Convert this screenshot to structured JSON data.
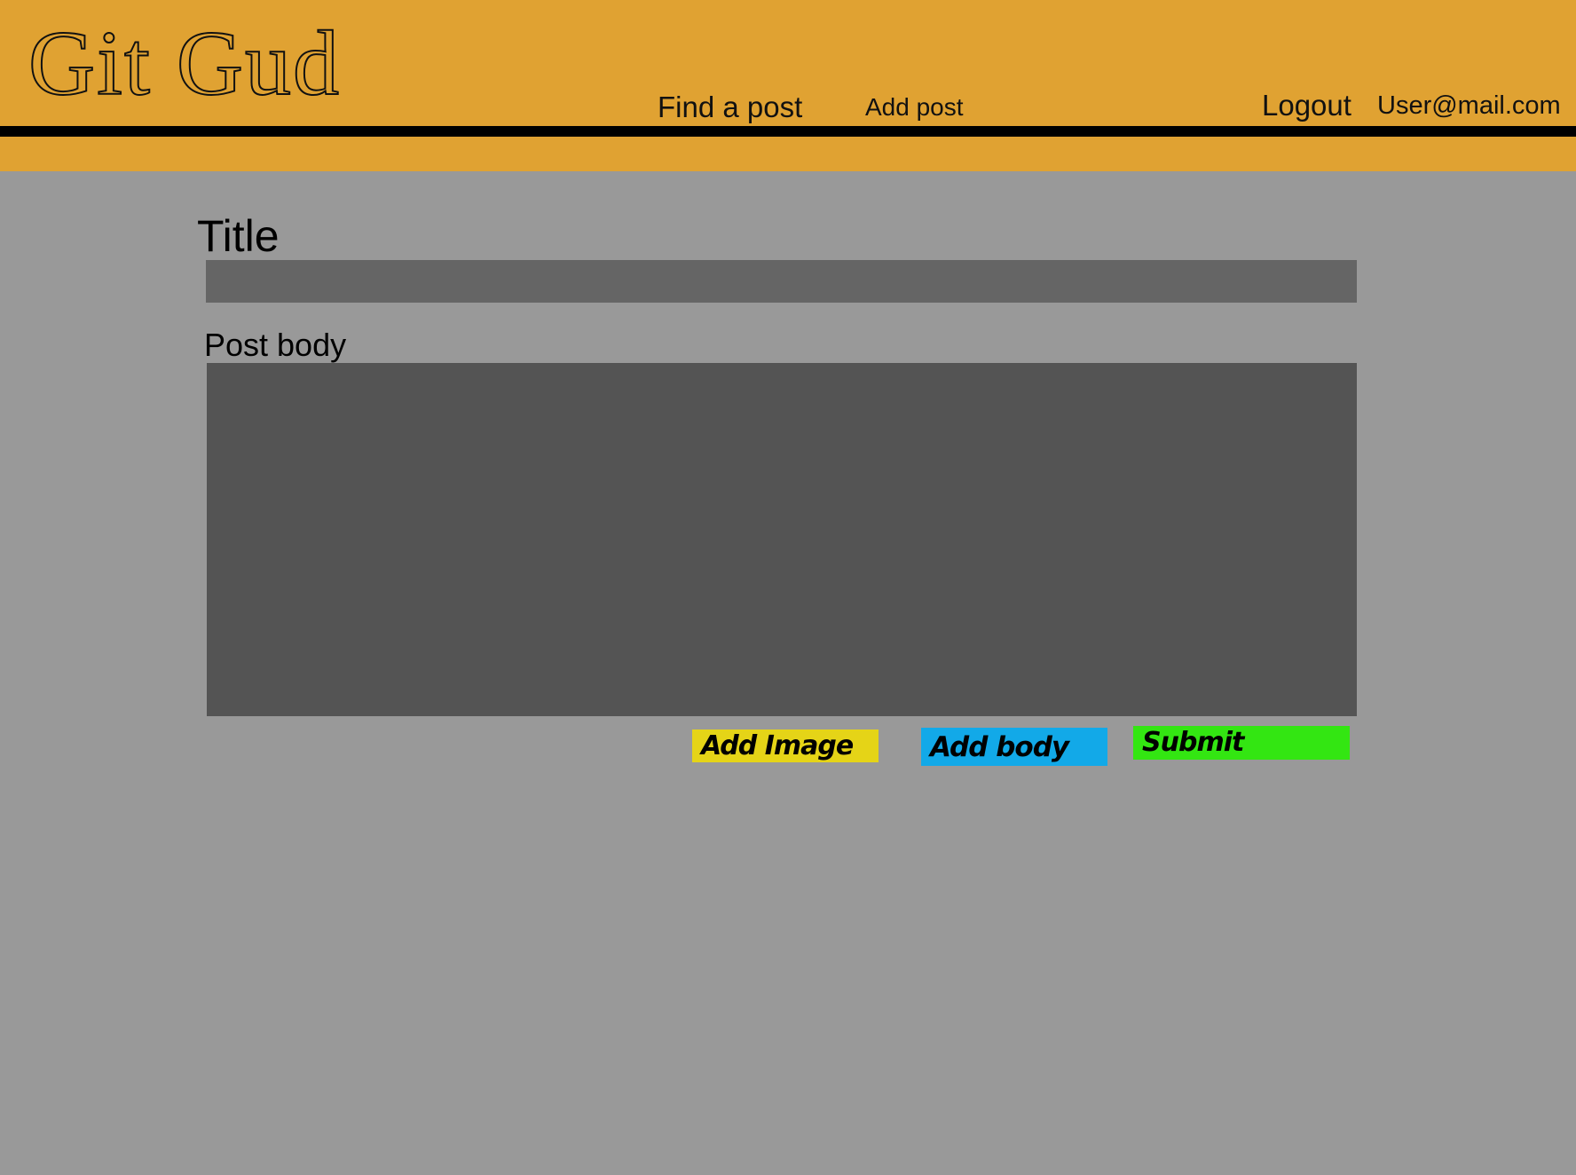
{
  "header": {
    "logo_text": "Git Gud",
    "nav": {
      "find_post": "Find a post",
      "add_post": "Add post",
      "logout": "Logout",
      "user_email": "User@mail.com"
    }
  },
  "form": {
    "title_label": "Title",
    "title_value": "",
    "body_label": "Post body",
    "body_value": "",
    "buttons": {
      "add_image": "Add Image",
      "add_body": "Add body",
      "submit": "Submit"
    }
  },
  "colors": {
    "header_bg": "#e0a232",
    "page_bg": "#999999",
    "title_field_bg": "#656565",
    "body_field_bg": "#545454",
    "add_image_bg": "#e5d417",
    "add_body_bg": "#12a9e8",
    "submit_bg": "#33e612"
  }
}
